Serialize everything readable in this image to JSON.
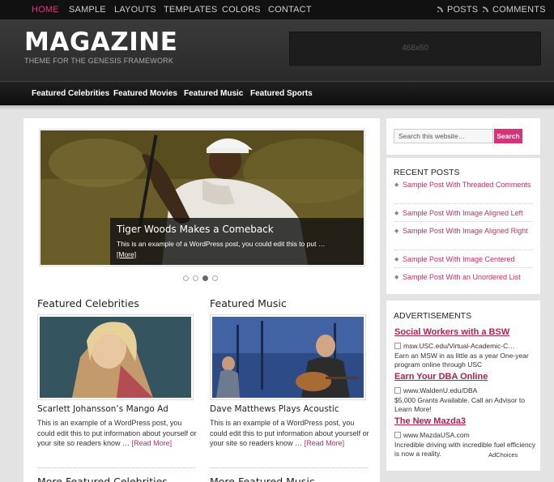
{
  "top_nav": {
    "items": [
      "HOME",
      "SAMPLE",
      "LAYOUTS",
      "TEMPLATES",
      "COLORS",
      "CONTACT"
    ],
    "right": [
      "POSTS",
      "COMMENTS"
    ]
  },
  "header": {
    "logo": "MAGAZINE",
    "tagline": "THEME FOR THE GENESIS FRAMEWORK",
    "ad_placeholder": "468x60"
  },
  "category_nav": [
    "Featured Celebrities",
    "Featured Movies",
    "Featured Music",
    "Featured Sports"
  ],
  "slider": {
    "title": "Tiger Woods Makes a Comeback",
    "excerpt": "This is an example of a WordPress post, you could edit this to put …",
    "more": "[More]",
    "active_slide": 3,
    "slide_count": 4
  },
  "sections": [
    {
      "title": "Featured Celebrities",
      "post_title": "Scarlett Johansson’s Mango Ad",
      "excerpt": "This is an example of a WordPress post, you could edit this to put information about yourself or your site so readers know … ",
      "more": "[Read More]",
      "more_title": "More Featured Celebrities"
    },
    {
      "title": "Featured Music",
      "post_title": "Dave Matthews Plays Acoustic",
      "excerpt": "This is an example of a WordPress post, you could edit this to put information about yourself or your site so readers know … ",
      "more": "[Read More]",
      "more_title": "More Featured Music"
    }
  ],
  "sidebar": {
    "search_placeholder": "Search this website…",
    "search_button": "Search",
    "recent_title": "RECENT POSTS",
    "recent_posts": [
      "Sample Post With Threaded Comments",
      "Sample Post With Image Aligned Left",
      "Sample Post With Image Aligned Right",
      "Sample Post With Image Centered",
      "Sample Post With an Unordered List"
    ],
    "ads_title": "ADVERTISEMENTS",
    "ads": [
      {
        "title": "Social Workers with a BSW",
        "url": "msw.USC.edu/Virtual-Academic-C…",
        "desc": "Earn an MSW in as little as a year One-year program online through USC"
      },
      {
        "title": "Earn Your DBA Online",
        "url": "www.WaldenU.edu/DBA",
        "desc": "$5,000 Grants Available. Call an Advisor to Learn More!"
      },
      {
        "title": "The New Mazda3",
        "url": "www.MazdaUSA.com",
        "desc": "Incredible driving with incredible fuel efficiency is now a reality."
      }
    ],
    "adchoices": "AdChoices"
  },
  "colors": {
    "accent": "#d83378",
    "link": "#c0305f"
  }
}
